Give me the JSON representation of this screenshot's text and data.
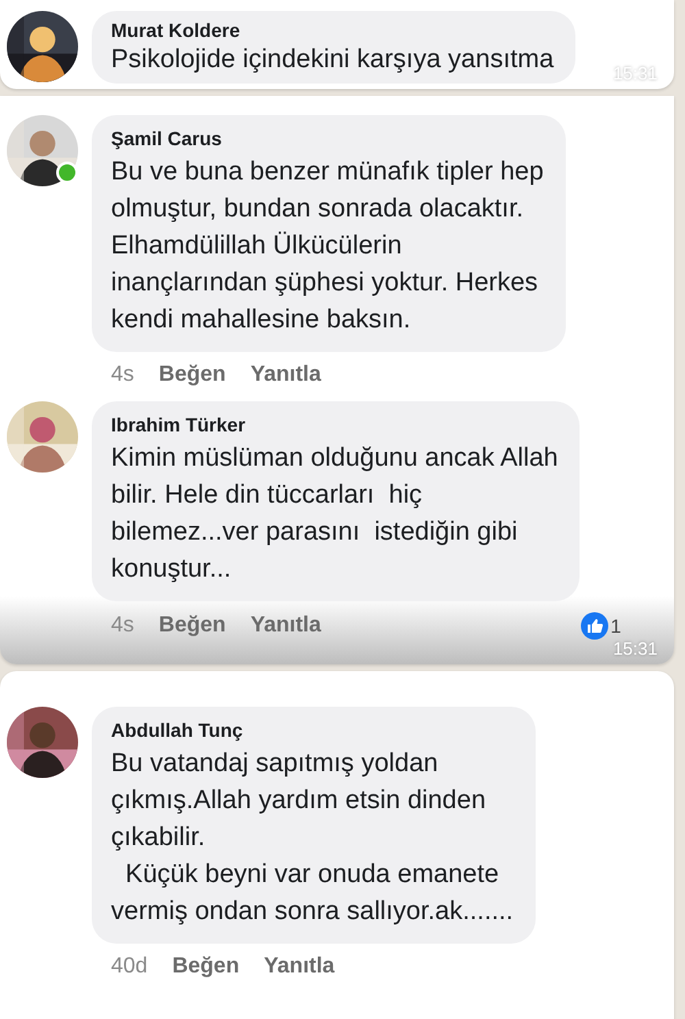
{
  "panels": [
    {
      "time": "15:31",
      "comments": [
        {
          "name": "Murat Koldere",
          "text": "Psikolojide içindekini karşıya yansıtma",
          "online": false
        }
      ]
    },
    {
      "time": "15:31",
      "comments": [
        {
          "name": "Şamil Carus",
          "text": "Bu ve buna benzer münafık tipler hep\nolmuştur, bundan sonrada olacaktır.\nElhamdülillah Ülkücülerin\ninançlarından şüphesi yoktur. Herkes\nkendi mahallesine baksın.",
          "online": true,
          "age": "4s",
          "like": "Beğen",
          "reply": "Yanıtla"
        },
        {
          "name": "Ibrahim Türker",
          "text": "Kimin müslüman olduğunu ancak Allah\nbilir. Hele din tüccarları  hiç\nbilemez...ver parasını  istediğin gibi\nkonuştur...",
          "online": false,
          "age": "4s",
          "like": "Beğen",
          "reply": "Yanıtla",
          "reactions": "1"
        }
      ]
    },
    {
      "comments": [
        {
          "name": "Abdullah Tunç",
          "text": "Bu vatandaj sapıtmış yoldan\nçıkmış.Allah yardım etsin dinden\nçıkabilir.\n  Küçük beyni var onuda emanete\nvermiş ondan sonra sallıyor.ak.......",
          "online": false,
          "age": "40d",
          "like": "Beğen",
          "reply": "Yanıtla"
        }
      ]
    }
  ]
}
